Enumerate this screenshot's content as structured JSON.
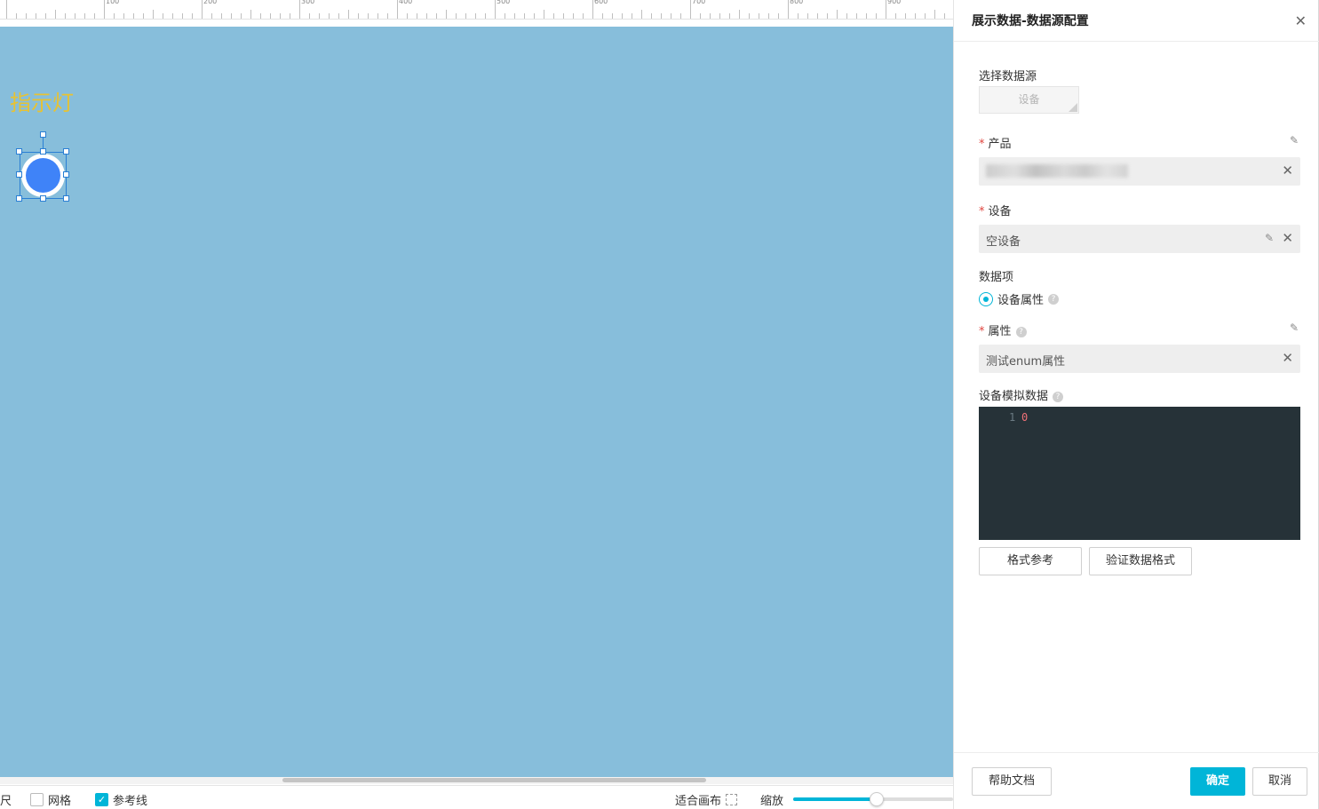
{
  "ruler": {
    "labels": [
      "100",
      "200",
      "300",
      "400",
      "500",
      "600",
      "700",
      "800",
      "900"
    ]
  },
  "board": {
    "title": "指示灯",
    "title_color": "#e7c233",
    "background": "#87bedb",
    "indicator_color": "#3f83f8"
  },
  "bottom_bar": {
    "ruler_label_partial": "尺",
    "grid_label": "网格",
    "grid_checked": false,
    "guides_label": "参考线",
    "guides_checked": true,
    "fit_label": "适合画布",
    "zoom_label": "缩放",
    "zoom_level": 0.52
  },
  "panel": {
    "title": "展示数据-数据源配置",
    "close_icon": "close-icon",
    "source": {
      "label": "选择数据源",
      "button": "设备"
    },
    "product": {
      "label": "产品",
      "required": "*",
      "value_redacted": true
    },
    "device": {
      "label": "设备",
      "required": "*",
      "value": "空设备"
    },
    "data_item": {
      "label": "数据项",
      "option": "设备属性",
      "selected": true
    },
    "property": {
      "label": "属性",
      "required": "*",
      "value": "测试enum属性"
    },
    "mock_data": {
      "label": "设备模拟数据",
      "line_number": "1",
      "code": "0"
    },
    "format_ref_button": "格式参考",
    "validate_button": "验证数据格式",
    "help_doc_button": "帮助文档",
    "confirm_button": "确定",
    "cancel_button": "取消",
    "accent_color": "#00b5d8"
  }
}
